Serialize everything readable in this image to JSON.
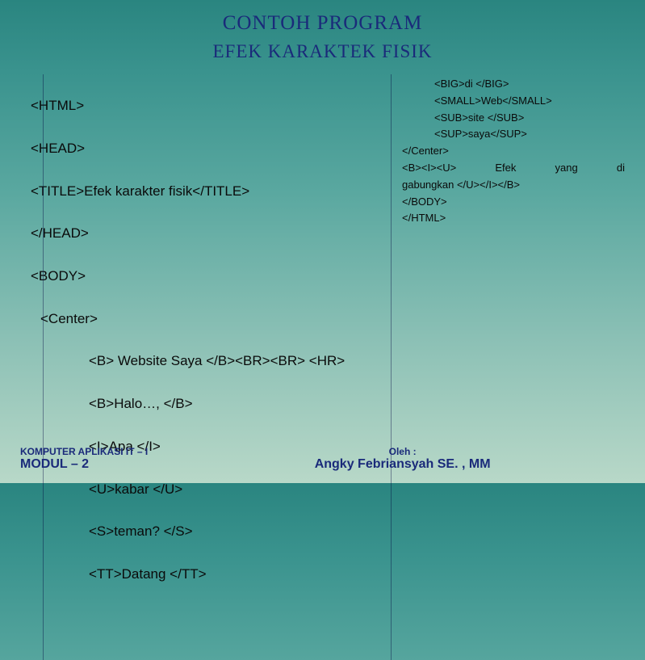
{
  "header": {
    "title": "CONTOH PROGRAM",
    "subtitle": "EFEK KARAKTEK FISIK"
  },
  "leftCode": {
    "l1": "<HTML>",
    "l2": "<HEAD>",
    "l3": "<TITLE>Efek karakter fisik</TITLE>",
    "l4": "</HEAD>",
    "l5": "<BODY>",
    "l6": "<Center>",
    "l7": "<B> Website Saya </B><BR><BR> <HR>",
    "l8": "<B>Halo…, </B>",
    "l9": "<I>Apa </I>",
    "l10": "<U>kabar </U>",
    "l11": "<S>teman? </S>",
    "l12": "<TT>Datang </TT>"
  },
  "rightCode": {
    "r1": "<BIG>di </BIG>",
    "r2": "<SMALL>Web</SMALL>",
    "r3": "<SUB>site </SUB>",
    "r4": "<SUP>saya</SUP>",
    "r5": "</Center>",
    "r6a": "<B><I><U>",
    "r6b": "Efek",
    "r6c": "yang",
    "r6d": "di",
    "r7": "gabungkan </U></I></B>",
    "r8": "</BODY>",
    "r9": "</HTML>"
  },
  "footer": {
    "course": "KOMPUTER APLIKASI IT – I",
    "module": "MODUL – 2",
    "byLabel": "Oleh :",
    "author": "Angky Febriansyah SE. , MM"
  }
}
